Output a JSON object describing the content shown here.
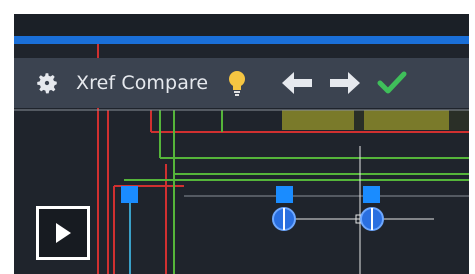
{
  "toolbar": {
    "title": "Xref Compare",
    "icons": [
      "gear-icon",
      "lightbulb-icon",
      "arrow-left-icon",
      "arrow-right-icon",
      "checkmark-icon"
    ]
  },
  "video": {
    "control": "play-icon"
  },
  "colors": {
    "background": "#1f242c",
    "toolbar": "#3b4350",
    "accent_blue": "#1a6fd8",
    "bulb": "#f5c542",
    "check": "#3fbf5a",
    "line_red": "#d03030",
    "line_green": "#55b53a",
    "line_olive": "#7a7a2a"
  }
}
